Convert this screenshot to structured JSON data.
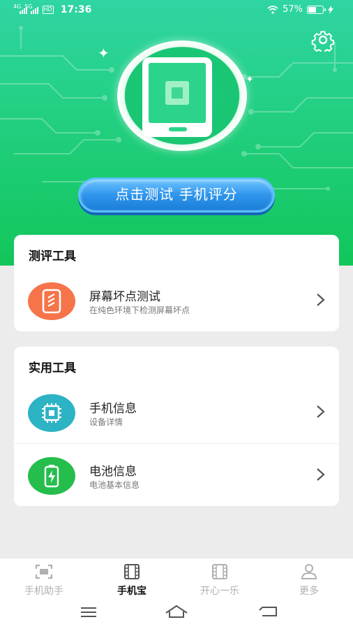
{
  "status_bar": {
    "network_1": "4G",
    "network_2": "5G",
    "hd": "HD",
    "time": "17:36",
    "battery_percent": "57%",
    "battery_level": 0.57
  },
  "hero": {
    "test_button_label": "点击测试 手机评分"
  },
  "evaluation_tools": {
    "title": "测评工具",
    "items": [
      {
        "name": "屏幕坏点测试",
        "desc": "在纯色环境下检测屏幕坏点",
        "icon": "screen-test-icon",
        "color": "#f6744a"
      }
    ]
  },
  "practical_tools": {
    "title": "实用工具",
    "items": [
      {
        "name": "手机信息",
        "desc": "设备详情",
        "icon": "chip-icon",
        "color": "#2cb3c4"
      },
      {
        "name": "电池信息",
        "desc": "电池基本信息",
        "icon": "battery-icon",
        "color": "#25be4c"
      }
    ]
  },
  "bottom_nav": {
    "tabs": [
      {
        "label": "手机助手",
        "icon": "scan-icon",
        "active": false
      },
      {
        "label": "手机宝",
        "icon": "film-icon",
        "active": true
      },
      {
        "label": "开心一乐",
        "icon": "film-icon",
        "active": false
      },
      {
        "label": "更多",
        "icon": "user-icon",
        "active": false
      }
    ]
  },
  "colors": {
    "hero_green": "#12c65a",
    "button_blue": "#1b7ed8",
    "background": "#ececec"
  }
}
